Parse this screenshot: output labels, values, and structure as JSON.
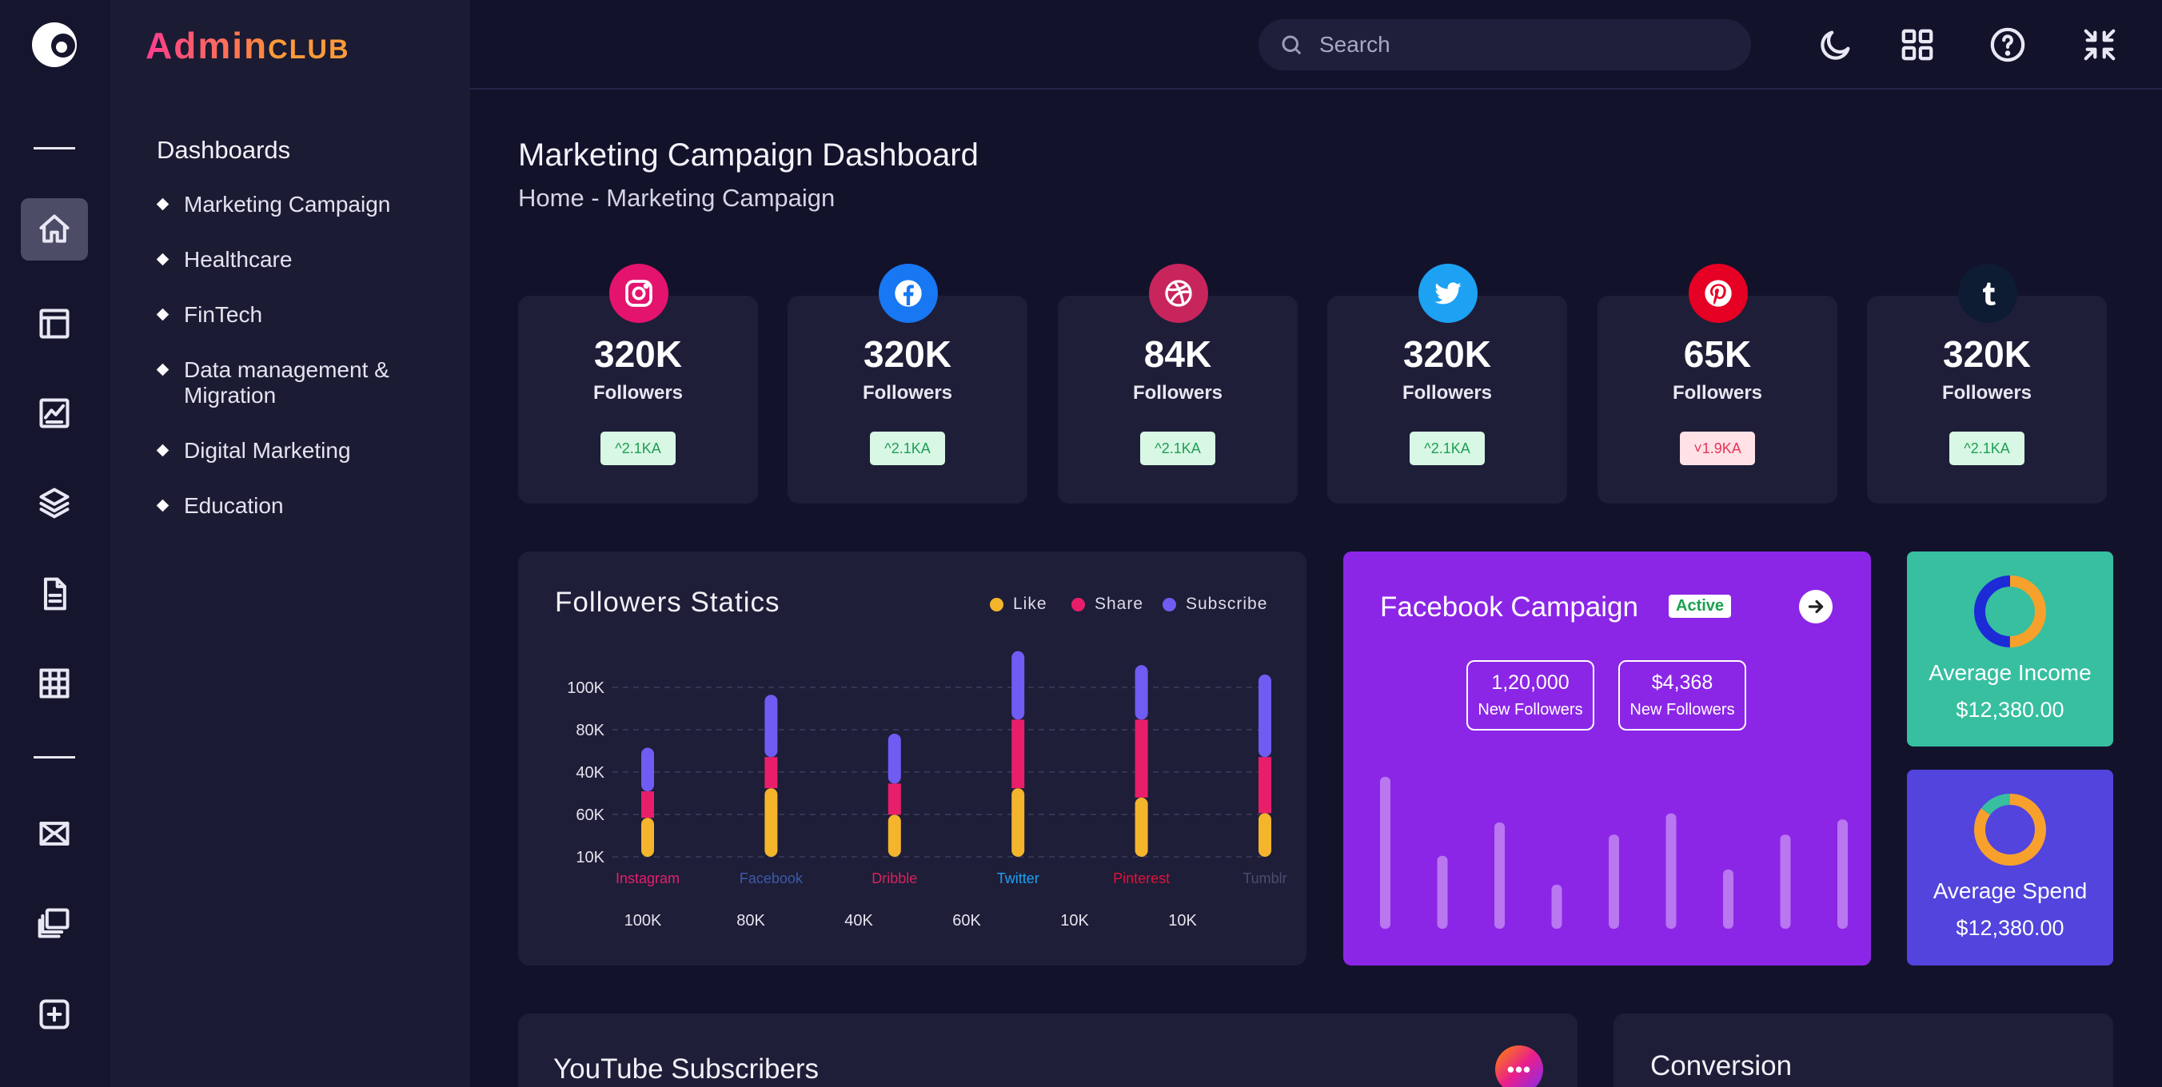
{
  "brand": {
    "part1": "Admin",
    "part2": "CLUB"
  },
  "search": {
    "placeholder": "Search"
  },
  "sidebar": {
    "title": "Dashboards",
    "items": [
      {
        "label": "Marketing Campaign"
      },
      {
        "label": "Healthcare"
      },
      {
        "label": "FinTech"
      },
      {
        "label": "Data management & Migration"
      },
      {
        "label": "Digital Marketing"
      },
      {
        "label": "Education"
      }
    ]
  },
  "header": {
    "title": "Marketing Campaign Dashboard",
    "breadcrumb": "Home - Marketing Campaign"
  },
  "social": [
    {
      "network": "instagram",
      "icon": "instagram-icon",
      "color": "#e4136e",
      "value": "320K",
      "label": "Followers",
      "trend": "^2.1KA",
      "direction": "up"
    },
    {
      "network": "facebook",
      "icon": "facebook-icon",
      "color": "#1877f2",
      "value": "320K",
      "label": "Followers",
      "trend": "^2.1KA",
      "direction": "up"
    },
    {
      "network": "dribbble",
      "icon": "dribbble-icon",
      "color": "#c8255d",
      "value": "84K",
      "label": "Followers",
      "trend": "^2.1KA",
      "direction": "up"
    },
    {
      "network": "twitter",
      "icon": "twitter-icon",
      "color": "#1da1f2",
      "value": "320K",
      "label": "Followers",
      "trend": "^2.1KA",
      "direction": "up"
    },
    {
      "network": "pinterest",
      "icon": "pinterest-icon",
      "color": "#e60023",
      "value": "65K",
      "label": "Followers",
      "trend": "˅1.9KA",
      "direction": "down"
    },
    {
      "network": "tumblr",
      "icon": "tumblr-icon",
      "color": "#0d1b33",
      "value": "320K",
      "label": "Followers",
      "trend": "^2.1KA",
      "direction": "up"
    }
  ],
  "followers": {
    "title": "Followers Statics",
    "legend": [
      {
        "name": "Like",
        "color": "#f4b52c"
      },
      {
        "name": "Share",
        "color": "#e91e6a"
      },
      {
        "name": "Subscribe",
        "color": "#6f5cf2"
      }
    ]
  },
  "chart_data": {
    "type": "bar",
    "stacked": true,
    "categories": [
      "Instagram",
      "Facebook",
      "Dribble",
      "Twitter",
      "Pinterest",
      "Tumblr"
    ],
    "category_colors": [
      "#e91e6a",
      "#3c5aa8",
      "#d4245f",
      "#1da1f2",
      "#e0113c",
      "#4a4d6e"
    ],
    "y_tick_labels": [
      "100K",
      "80K",
      "40K",
      "60K",
      "10K"
    ],
    "bottom_labels": [
      "100K",
      "80K",
      "40K",
      "60K",
      "10K",
      "10K"
    ],
    "series": [
      {
        "name": "Like",
        "color": "#f4b52c",
        "values": [
          25,
          44,
          27,
          44,
          38,
          28
        ]
      },
      {
        "name": "Share",
        "color": "#e91e6a",
        "values": [
          17,
          20,
          20,
          44,
          50,
          36
        ]
      },
      {
        "name": "Subscribe",
        "color": "#6f5cf2",
        "values": [
          28,
          40,
          32,
          44,
          35,
          53
        ]
      }
    ],
    "grid": true,
    "legend_position": "top-right"
  },
  "facebook": {
    "title": "Facebook Campaign",
    "status": "Active",
    "stats": [
      {
        "value": "1,20,000",
        "label": "New Followers"
      },
      {
        "value": "$4,368",
        "label": "New Followers"
      }
    ],
    "bars": [
      100,
      48,
      70,
      29,
      62,
      76,
      39,
      62,
      72
    ]
  },
  "income": {
    "title": "Average Income",
    "value": "$12,380.00",
    "bg": "#37bfa0",
    "parts": [
      {
        "color": "#f7a12c",
        "pct": 0.5
      },
      {
        "color": "#1c2bd6",
        "pct": 0.5
      }
    ]
  },
  "spend": {
    "title": "Average Spend",
    "value": "$12,380.00",
    "bg": "#5244dd",
    "parts": [
      {
        "color": "#f7a12c",
        "pct": 0.85
      },
      {
        "color": "#37bfa0",
        "pct": 0.15
      }
    ]
  },
  "youtube": {
    "title": "YouTube Subscribers",
    "more": "•••"
  },
  "conversion": {
    "title": "Conversion"
  }
}
